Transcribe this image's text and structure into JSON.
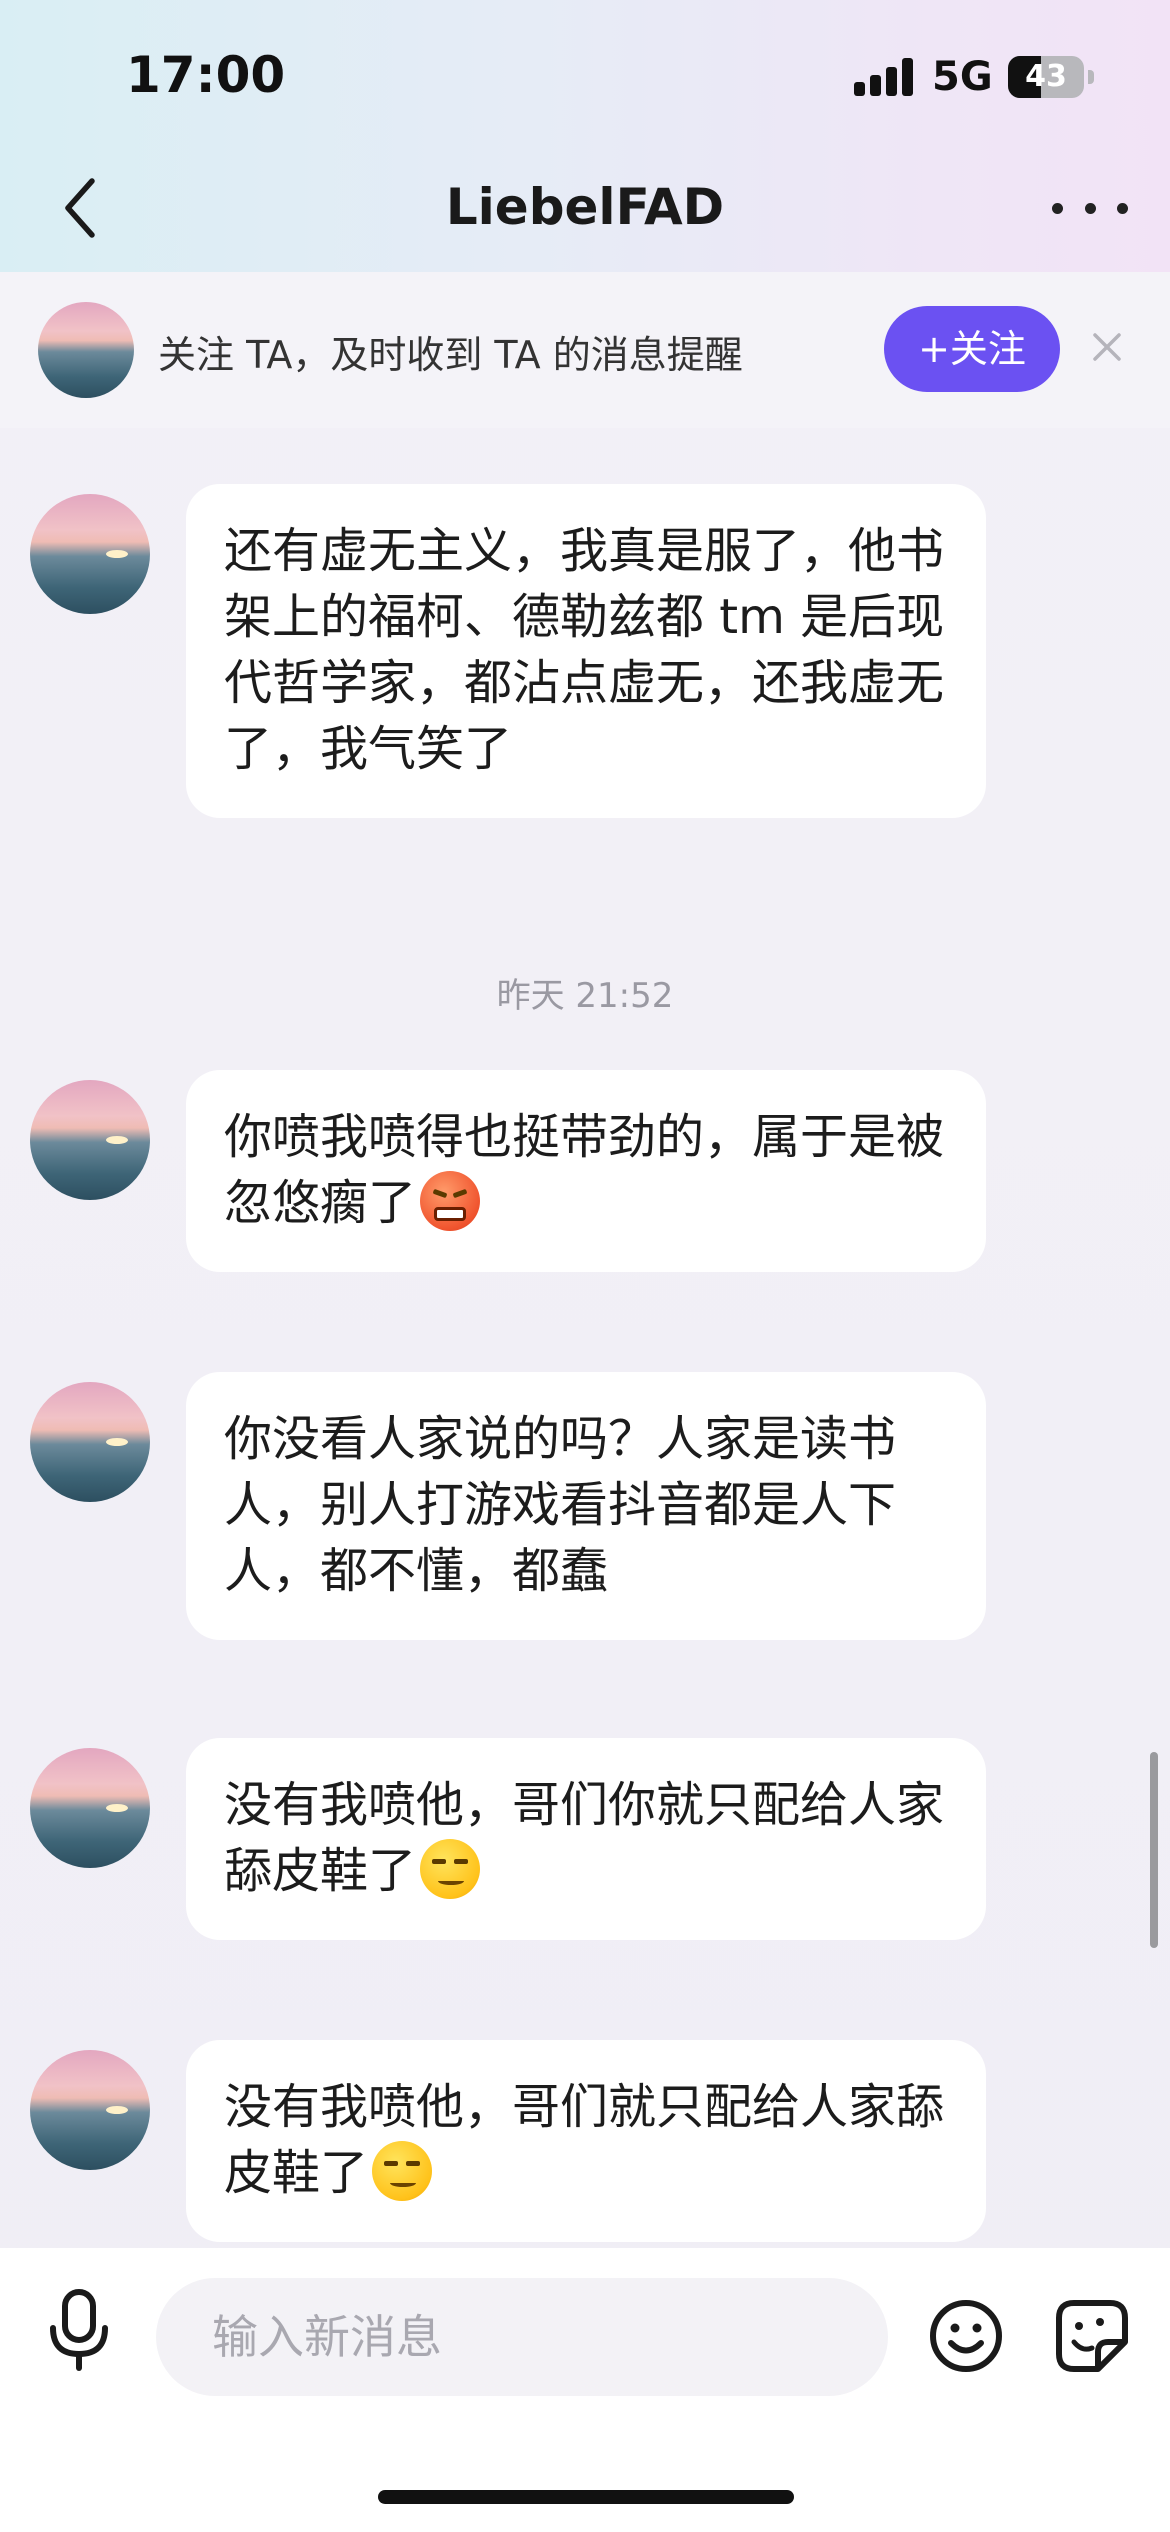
{
  "status_bar": {
    "time": "17:00",
    "network": "5G",
    "battery": "43",
    "battery_level_percent": 43
  },
  "nav": {
    "title": "LiebelFAD",
    "back_icon": "chevron-left-icon",
    "more_icon": "more-horizontal-icon"
  },
  "follow_banner": {
    "text": "关注 TA，及时收到 TA 的消息提醒",
    "button_label": "+关注",
    "button_color": "#6b51f2",
    "close_icon": "close-icon"
  },
  "messages": [
    {
      "text": "还有虚无主义，我真是服了，他书架上的福柯、德勒兹都 tm 是后现代哲学家，都沾点虚无，还我虚无了，我气笑了",
      "emoji": null
    },
    {
      "text": "你喷我喷得也挺带劲的，属于是被忽悠瘸了",
      "emoji": "angry-face-emoji"
    },
    {
      "text": "你没看人家说的吗？人家是读书人，别人打游戏看抖音都是人下人，都不懂，都蠢",
      "emoji": null
    },
    {
      "text": "没有我喷他，哥们你就只配给人家舔皮鞋了",
      "emoji": "smirk-face-emoji"
    },
    {
      "text": "没有我喷他，哥们就只配给人家舔皮鞋了",
      "emoji": "smirk-face-emoji"
    }
  ],
  "timestamp": "昨天 21:52",
  "input": {
    "placeholder": "输入新消息",
    "value": "",
    "mic_icon": "microphone-icon",
    "emoji_icon": "smiley-icon",
    "sticker_icon": "sticker-icon"
  }
}
